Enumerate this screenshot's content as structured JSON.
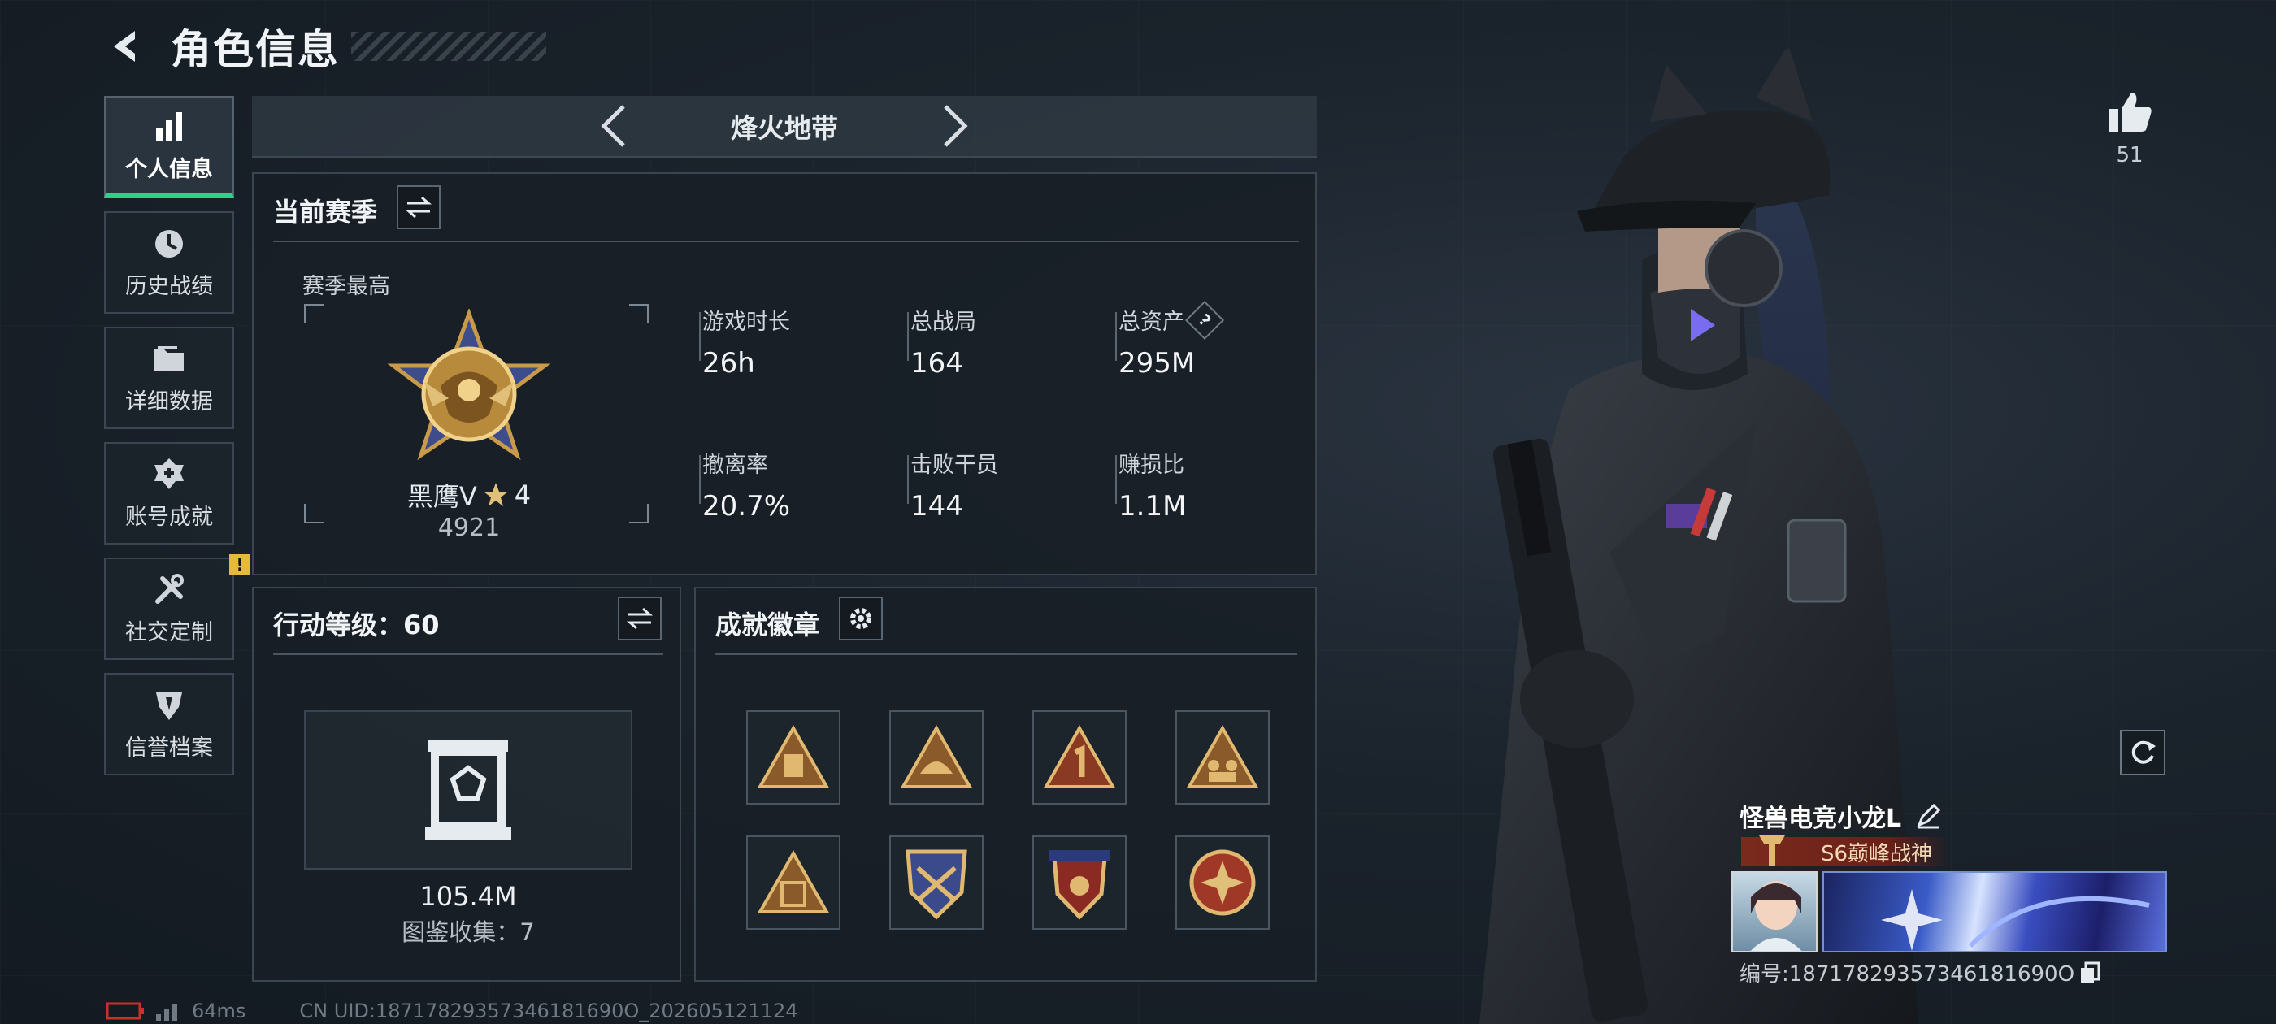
{
  "header": {
    "title": "角色信息"
  },
  "sidebar": {
    "items": [
      {
        "label": "个人信息",
        "icon": "bar-chart-icon",
        "active": true
      },
      {
        "label": "历史战绩",
        "icon": "history-icon"
      },
      {
        "label": "详细数据",
        "icon": "folder-icon"
      },
      {
        "label": "账号成就",
        "icon": "achievement-icon"
      },
      {
        "label": "社交定制",
        "icon": "tools-icon",
        "badge": "!"
      },
      {
        "label": "信誉档案",
        "icon": "reputation-icon"
      }
    ]
  },
  "mode": {
    "name": "烽火地带"
  },
  "season": {
    "title": "当前赛季",
    "best_label": "赛季最高",
    "rank_name": "黑鹰V",
    "rank_stars": "4",
    "rank_points": "4921",
    "stats": [
      {
        "label": "游戏时长",
        "value": "26h"
      },
      {
        "label": "总战局",
        "value": "164"
      },
      {
        "label": "总资产",
        "value": "295M",
        "help": "?"
      },
      {
        "label": "撤离率",
        "value": "20.7%"
      },
      {
        "label": "击败干员",
        "value": "144"
      },
      {
        "label": "赚损比",
        "value": "1.1M"
      }
    ]
  },
  "action_level": {
    "title": "行动等级：60",
    "value": "105.4M",
    "collection": "图鉴收集：7"
  },
  "achievements": {
    "title": "成就徽章",
    "badges": [
      {
        "icon": "badge-triangle-stamp-icon"
      },
      {
        "icon": "badge-triangle-helmet-icon"
      },
      {
        "icon": "badge-triangle-one-icon"
      },
      {
        "icon": "badge-triangle-squad-icon"
      },
      {
        "icon": "badge-triangle-s6-icon"
      },
      {
        "icon": "badge-shield-weapons-icon"
      },
      {
        "icon": "badge-shield-stars-icon"
      },
      {
        "icon": "badge-round-cross-icon"
      }
    ]
  },
  "profile": {
    "likes": "51",
    "player_name": "怪兽电竞小龙L",
    "rank_title": "S6巅峰战神",
    "player_id": "编号:18717829357346181690O"
  },
  "status": {
    "ping": "64ms",
    "uid": "CN UID:18717829357346181690O_202605121124"
  },
  "colors": {
    "accent": "#2fd08a",
    "warning": "#e5b93a",
    "gold": "#c89a4a"
  }
}
